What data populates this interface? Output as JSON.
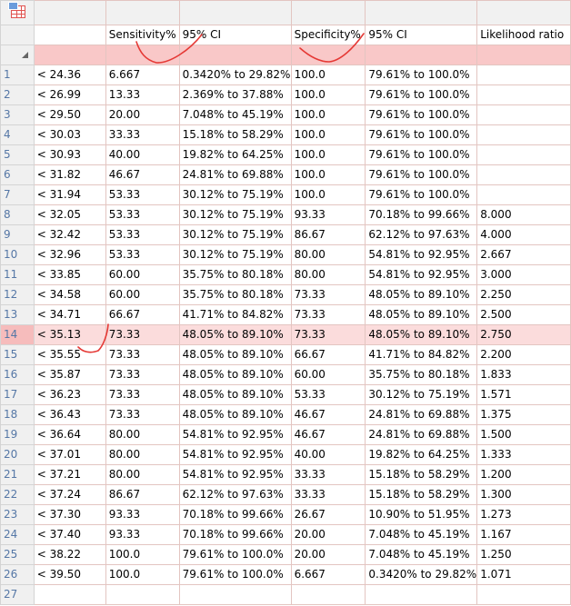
{
  "columns": [
    "Sensitivity%",
    "95% CI",
    "Specificity%",
    "95% CI",
    "Likelihood ratio"
  ],
  "rows": [
    [
      "< 24.36",
      "6.667",
      "0.3420% to 29.82%",
      "100.0",
      "79.61% to 100.0%",
      ""
    ],
    [
      "< 26.99",
      "13.33",
      "2.369% to 37.88%",
      "100.0",
      "79.61% to 100.0%",
      ""
    ],
    [
      "< 29.50",
      "20.00",
      "7.048% to 45.19%",
      "100.0",
      "79.61% to 100.0%",
      ""
    ],
    [
      "< 30.03",
      "33.33",
      "15.18% to 58.29%",
      "100.0",
      "79.61% to 100.0%",
      ""
    ],
    [
      "< 30.93",
      "40.00",
      "19.82% to 64.25%",
      "100.0",
      "79.61% to 100.0%",
      ""
    ],
    [
      "< 31.82",
      "46.67",
      "24.81% to 69.88%",
      "100.0",
      "79.61% to 100.0%",
      ""
    ],
    [
      "< 31.94",
      "53.33",
      "30.12% to 75.19%",
      "100.0",
      "79.61% to 100.0%",
      ""
    ],
    [
      "< 32.05",
      "53.33",
      "30.12% to 75.19%",
      "93.33",
      "70.18% to 99.66%",
      "8.000"
    ],
    [
      "< 32.42",
      "53.33",
      "30.12% to 75.19%",
      "86.67",
      "62.12% to 97.63%",
      "4.000"
    ],
    [
      "< 32.96",
      "53.33",
      "30.12% to 75.19%",
      "80.00",
      "54.81% to 92.95%",
      "2.667"
    ],
    [
      "< 33.85",
      "60.00",
      "35.75% to 80.18%",
      "80.00",
      "54.81% to 92.95%",
      "3.000"
    ],
    [
      "< 34.58",
      "60.00",
      "35.75% to 80.18%",
      "73.33",
      "48.05% to 89.10%",
      "2.250"
    ],
    [
      "< 34.71",
      "66.67",
      "41.71% to 84.82%",
      "73.33",
      "48.05% to 89.10%",
      "2.500"
    ],
    [
      "< 35.13",
      "73.33",
      "48.05% to 89.10%",
      "73.33",
      "48.05% to 89.10%",
      "2.750"
    ],
    [
      "< 35.55",
      "73.33",
      "48.05% to 89.10%",
      "66.67",
      "41.71% to 84.82%",
      "2.200"
    ],
    [
      "< 35.87",
      "73.33",
      "48.05% to 89.10%",
      "60.00",
      "35.75% to 80.18%",
      "1.833"
    ],
    [
      "< 36.23",
      "73.33",
      "48.05% to 89.10%",
      "53.33",
      "30.12% to 75.19%",
      "1.571"
    ],
    [
      "< 36.43",
      "73.33",
      "48.05% to 89.10%",
      "46.67",
      "24.81% to 69.88%",
      "1.375"
    ],
    [
      "< 36.64",
      "80.00",
      "54.81% to 92.95%",
      "46.67",
      "24.81% to 69.88%",
      "1.500"
    ],
    [
      "< 37.01",
      "80.00",
      "54.81% to 92.95%",
      "40.00",
      "19.82% to 64.25%",
      "1.333"
    ],
    [
      "< 37.21",
      "80.00",
      "54.81% to 92.95%",
      "33.33",
      "15.18% to 58.29%",
      "1.200"
    ],
    [
      "< 37.24",
      "86.67",
      "62.12% to 97.63%",
      "33.33",
      "15.18% to 58.29%",
      "1.300"
    ],
    [
      "< 37.30",
      "93.33",
      "70.18% to 99.66%",
      "26.67",
      "10.90% to 51.95%",
      "1.273"
    ],
    [
      "< 37.40",
      "93.33",
      "70.18% to 99.66%",
      "20.00",
      "7.048% to 45.19%",
      "1.167"
    ],
    [
      "< 38.22",
      "100.0",
      "79.61% to 100.0%",
      "20.00",
      "7.048% to 45.19%",
      "1.250"
    ],
    [
      "< 39.50",
      "100.0",
      "79.61% to 100.0%",
      "6.667",
      "0.3420% to 29.82%",
      "1.071"
    ],
    [
      "",
      "",
      "",
      "",
      "",
      ""
    ]
  ],
  "selected_row_number": "14",
  "accent_color": "#e53935",
  "icons": [
    "table-icon",
    "sort-corner-icon"
  ]
}
